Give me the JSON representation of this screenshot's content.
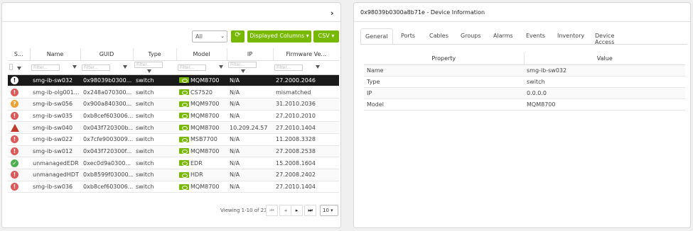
{
  "left_panel": {
    "collapse_icon": "chevron-right-icon",
    "toolbar": {
      "filter_select": "All",
      "refresh_icon": "refresh-icon",
      "displayed_columns": "Displayed Columns ▾",
      "csv": "CSV ▾"
    },
    "columns": [
      "S...",
      "Name",
      "GUID",
      "Type",
      "Model",
      "IP",
      "Firmware Ve..."
    ],
    "filter_placeholder": "Filter...",
    "rows": [
      {
        "severity": "info-white",
        "sev_glyph": "!",
        "name": "smg-ib-sw032",
        "guid": "0x98039b0300...",
        "type": "switch",
        "model": "MQM8700",
        "ip": "N/A",
        "firmware": "27.2000.2046",
        "selected": true
      },
      {
        "severity": "critical",
        "sev_glyph": "!",
        "name": "smg-ib-olg001...",
        "guid": "0x248a070300...",
        "type": "switch",
        "model": "CS7520",
        "ip": "N/A",
        "firmware": "mismatched"
      },
      {
        "severity": "warning",
        "sev_glyph": "?",
        "name": "smg-ib-sw056",
        "guid": "0x900a840300...",
        "type": "switch",
        "model": "MQM9700",
        "ip": "N/A",
        "firmware": "31.2010.2036"
      },
      {
        "severity": "critical",
        "sev_glyph": "!",
        "name": "smg-ib-sw035",
        "guid": "0xb8cef603006...",
        "type": "switch",
        "model": "MQM8700",
        "ip": "N/A",
        "firmware": "27.2010.2010"
      },
      {
        "severity": "alert-triangle",
        "sev_glyph": "!",
        "name": "smg-ib-sw040",
        "guid": "0x043f720300b...",
        "type": "switch",
        "model": "MQM8700",
        "ip": "10.209.24.57",
        "firmware": "27.2010.1404"
      },
      {
        "severity": "critical",
        "sev_glyph": "!",
        "name": "smg-ib-sw022",
        "guid": "0x7cfe9003009...",
        "type": "switch",
        "model": "MSB7700",
        "ip": "N/A",
        "firmware": "11.2008.3328"
      },
      {
        "severity": "critical",
        "sev_glyph": "!",
        "name": "smg-ib-sw012",
        "guid": "0x043f720300f...",
        "type": "switch",
        "model": "MQM8700",
        "ip": "N/A",
        "firmware": "27.2008.2538"
      },
      {
        "severity": "ok",
        "sev_glyph": "✓",
        "name": "unmanagedEDR",
        "guid": "0xec0d9a0300...",
        "type": "switch",
        "model": "EDR",
        "ip": "N/A",
        "firmware": "15.2008.1604"
      },
      {
        "severity": "critical",
        "sev_glyph": "!",
        "name": "unmanagedHDT",
        "guid": "0xb8599f03000...",
        "type": "switch",
        "model": "HDR",
        "ip": "N/A",
        "firmware": "27.2008.2402"
      },
      {
        "severity": "critical",
        "sev_glyph": "!",
        "name": "smg-ib-sw036",
        "guid": "0xb8cef603006...",
        "type": "switch",
        "model": "MQM8700",
        "ip": "N/A",
        "firmware": "27.2010.1404"
      }
    ],
    "pager": {
      "viewing": "Viewing 1-10 of 23",
      "first": "⏮",
      "prev": "◂",
      "next": "▸",
      "last": "⏭",
      "page_size": "10 ▾"
    }
  },
  "right_panel": {
    "title": "0x98039b0300a8b71e - Device Information",
    "tabs": [
      "General",
      "Ports",
      "Cables",
      "Groups",
      "Alarms",
      "Events",
      "Inventory",
      "Device Access"
    ],
    "active_tab": "General",
    "table_headers": [
      "Property",
      "Value"
    ],
    "properties": [
      {
        "property": "Name",
        "value": "smg-ib-sw032"
      },
      {
        "property": "Type",
        "value": "switch"
      },
      {
        "property": "IP",
        "value": "0.0.0.0"
      },
      {
        "property": "Model",
        "value": "MQM8700"
      }
    ]
  },
  "colors": {
    "accent": "#76b900",
    "critical": "#e05757",
    "warning": "#f0a030",
    "ok": "#4caf50",
    "selected_row": "#1a1a1a"
  }
}
